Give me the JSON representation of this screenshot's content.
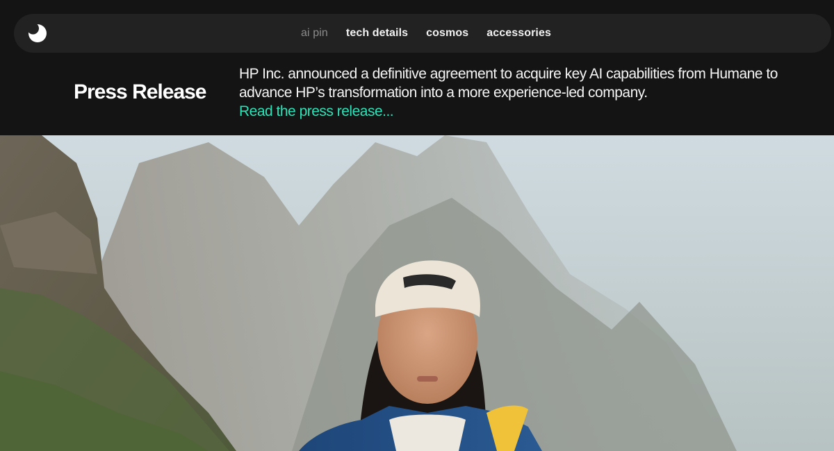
{
  "nav": {
    "logo_icon": "moon-logo-icon",
    "links": [
      {
        "label": "ai pin",
        "active": true
      },
      {
        "label": "tech details",
        "active": false
      },
      {
        "label": "cosmos",
        "active": false
      },
      {
        "label": "accessories",
        "active": false
      }
    ]
  },
  "press": {
    "title": "Press Release",
    "body": "HP Inc. announced a definitive agreement to acquire key AI capabilities from Humane to advance HP’s transformation into a more experience-led company.",
    "link_label": "Read the press release..."
  },
  "colors": {
    "background": "#141414",
    "nav_background": "#222222",
    "accent": "#2ee2b8",
    "nav_active": "#8c8c8c"
  }
}
